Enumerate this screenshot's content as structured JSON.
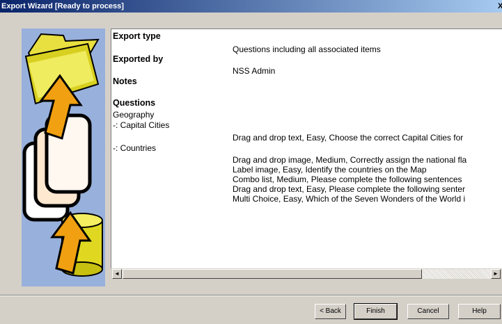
{
  "window": {
    "title": "Export Wizard [Ready to process]",
    "close_glyph": "X"
  },
  "summary": {
    "export_type_label": "Export type",
    "export_type_value": "Questions including all associated items",
    "exported_by_label": "Exported by",
    "exported_by_value": "NSS Admin",
    "notes_label": "Notes",
    "questions_label": "Questions",
    "category": "Geography",
    "sections": [
      {
        "name": "-: Capital Cities",
        "items": [
          "Drag and drop text, Easy, Choose the correct Capital Cities for"
        ]
      },
      {
        "name": "-: Countries",
        "items": [
          "Drag and drop image, Medium, Correctly assign the national fla",
          "Label image, Easy, Identify the countries on the Map",
          "Combo list, Medium, Please complete the following sentences",
          "Drag and drop text, Easy, Please complete the following senter",
          "Multi Choice, Easy, Which of the Seven Wonders of the World i"
        ]
      }
    ]
  },
  "scrollbar": {
    "left_arrow": "◄",
    "right_arrow": "►"
  },
  "buttons": {
    "back": "< Back",
    "finish": "Finish",
    "cancel": "Cancel",
    "help": "Help"
  }
}
